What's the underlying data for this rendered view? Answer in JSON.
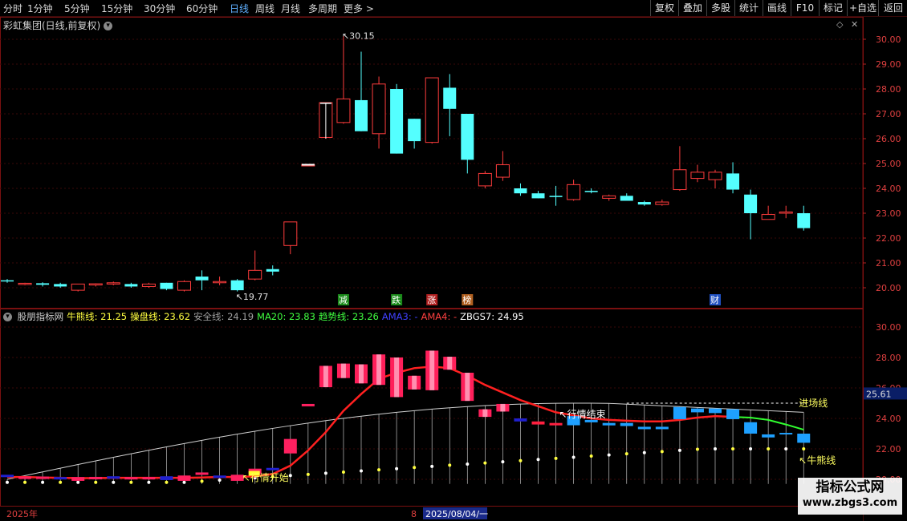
{
  "toolbar": {
    "periods": [
      "分时",
      "1分钟",
      "5分钟",
      "15分钟",
      "30分钟",
      "60分钟",
      "日线",
      "周线",
      "月线",
      "多周期",
      "更多"
    ],
    "active": "日线",
    "more_arrow": ">",
    "right_buttons": [
      "复权",
      "叠加",
      "多股",
      "统计",
      "画线",
      "F10",
      "标记",
      "+自选",
      "返回"
    ]
  },
  "main_chart": {
    "symbol": "彩虹集团(日线,前复权)",
    "high_label": "30.15",
    "low_label": "19.77",
    "y_ticks": [
      "30.00",
      "29.00",
      "28.00",
      "27.00",
      "26.00",
      "25.00",
      "24.00",
      "23.00",
      "22.00",
      "21.00",
      "20.00"
    ],
    "events": [
      "减",
      "跌",
      "涨",
      "榜",
      "财"
    ],
    "candles": [
      [
        20.3,
        20.35,
        20.2,
        20.28
      ],
      [
        20.15,
        20.2,
        20.1,
        20.18
      ],
      [
        20.18,
        20.22,
        20.05,
        20.12
      ],
      [
        20.15,
        20.2,
        20.0,
        20.05
      ],
      [
        19.9,
        20.15,
        19.85,
        20.15
      ],
      [
        20.12,
        20.18,
        20.05,
        20.16
      ],
      [
        20.15,
        20.25,
        20.1,
        20.2
      ],
      [
        20.15,
        20.2,
        20.0,
        20.05
      ],
      [
        20.05,
        20.2,
        20.0,
        20.15
      ],
      [
        20.2,
        20.2,
        19.9,
        19.95
      ],
      [
        19.9,
        20.3,
        19.85,
        20.25
      ],
      [
        20.45,
        20.7,
        19.9,
        20.3
      ],
      [
        20.25,
        20.45,
        20.1,
        20.25
      ],
      [
        20.3,
        20.35,
        19.85,
        19.9
      ],
      [
        20.35,
        21.5,
        20.3,
        20.7
      ],
      [
        20.75,
        20.9,
        20.5,
        20.65
      ],
      [
        21.7,
        22.6,
        21.35,
        22.65
      ],
      [
        24.95,
        24.95,
        24.95,
        24.95
      ],
      [
        26.05,
        27.45,
        26.0,
        27.45
      ],
      [
        26.65,
        30.15,
        26.6,
        27.6
      ],
      [
        27.55,
        29.5,
        26.3,
        26.3
      ],
      [
        26.2,
        28.5,
        25.6,
        28.2
      ],
      [
        28.0,
        28.2,
        25.4,
        25.4
      ],
      [
        26.8,
        26.8,
        25.6,
        25.9
      ],
      [
        25.85,
        28.45,
        25.8,
        28.45
      ],
      [
        28.05,
        28.6,
        26.1,
        27.2
      ],
      [
        27.0,
        27.0,
        24.6,
        25.15
      ],
      [
        24.1,
        24.7,
        24.0,
        24.6
      ],
      [
        24.45,
        25.5,
        24.3,
        24.95
      ],
      [
        24.0,
        24.2,
        23.7,
        23.8
      ],
      [
        23.8,
        23.9,
        23.6,
        23.6
      ],
      [
        23.7,
        24.1,
        23.3,
        23.65
      ],
      [
        23.55,
        24.35,
        23.5,
        24.15
      ],
      [
        23.9,
        24.0,
        23.8,
        23.85
      ],
      [
        23.6,
        23.75,
        23.5,
        23.7
      ],
      [
        23.7,
        23.8,
        23.5,
        23.5
      ],
      [
        23.45,
        23.5,
        23.3,
        23.35
      ],
      [
        23.35,
        23.55,
        23.3,
        23.45
      ],
      [
        23.95,
        25.7,
        23.9,
        24.75
      ],
      [
        24.4,
        24.95,
        24.25,
        24.65
      ],
      [
        24.35,
        24.75,
        24.0,
        24.65
      ],
      [
        24.6,
        25.05,
        23.8,
        23.95
      ],
      [
        23.75,
        23.95,
        21.95,
        23.0
      ],
      [
        22.75,
        23.3,
        22.75,
        22.95
      ],
      [
        23.0,
        23.3,
        22.8,
        23.05
      ],
      [
        23.0,
        23.3,
        22.3,
        22.4
      ]
    ]
  },
  "sub_chart": {
    "legend": [
      {
        "text": "股朋指标网",
        "color": "#d0d0d0"
      },
      {
        "text": "牛熊线: 21.25",
        "color": "#ffff40"
      },
      {
        "text": "操盘线: 23.62",
        "color": "#ffff40"
      },
      {
        "text": "安全线: 24.19",
        "color": "#a0a0a0"
      },
      {
        "text": "MA20: 23.83",
        "color": "#40ff40"
      },
      {
        "text": "趋势线: 23.26",
        "color": "#40ff40"
      },
      {
        "text": "AMA3: -",
        "color": "#4040ff"
      },
      {
        "text": "AMA4: -",
        "color": "#ff4040"
      },
      {
        "text": "ZBGS7: 24.95",
        "color": "#ffffff"
      }
    ],
    "y_ticks": [
      "30.00",
      "28.00",
      "26.00",
      "24.00",
      "22.00",
      "20.00"
    ],
    "current_value": "25.61",
    "labels": {
      "entry": "进场线",
      "bull": "牛熊线",
      "start": "行情开始",
      "end": "行情结束"
    }
  },
  "footer": {
    "year": "2025年",
    "marker": "8",
    "date": "2025/08/04/一"
  },
  "watermark": {
    "line1": "指标公式网",
    "line2": "www.zbgs3.com"
  },
  "colors": {
    "up": "#ff3c3c",
    "down": "#54ffff",
    "cyan_bar": "#1e9bff",
    "ma": "#ff2020"
  }
}
